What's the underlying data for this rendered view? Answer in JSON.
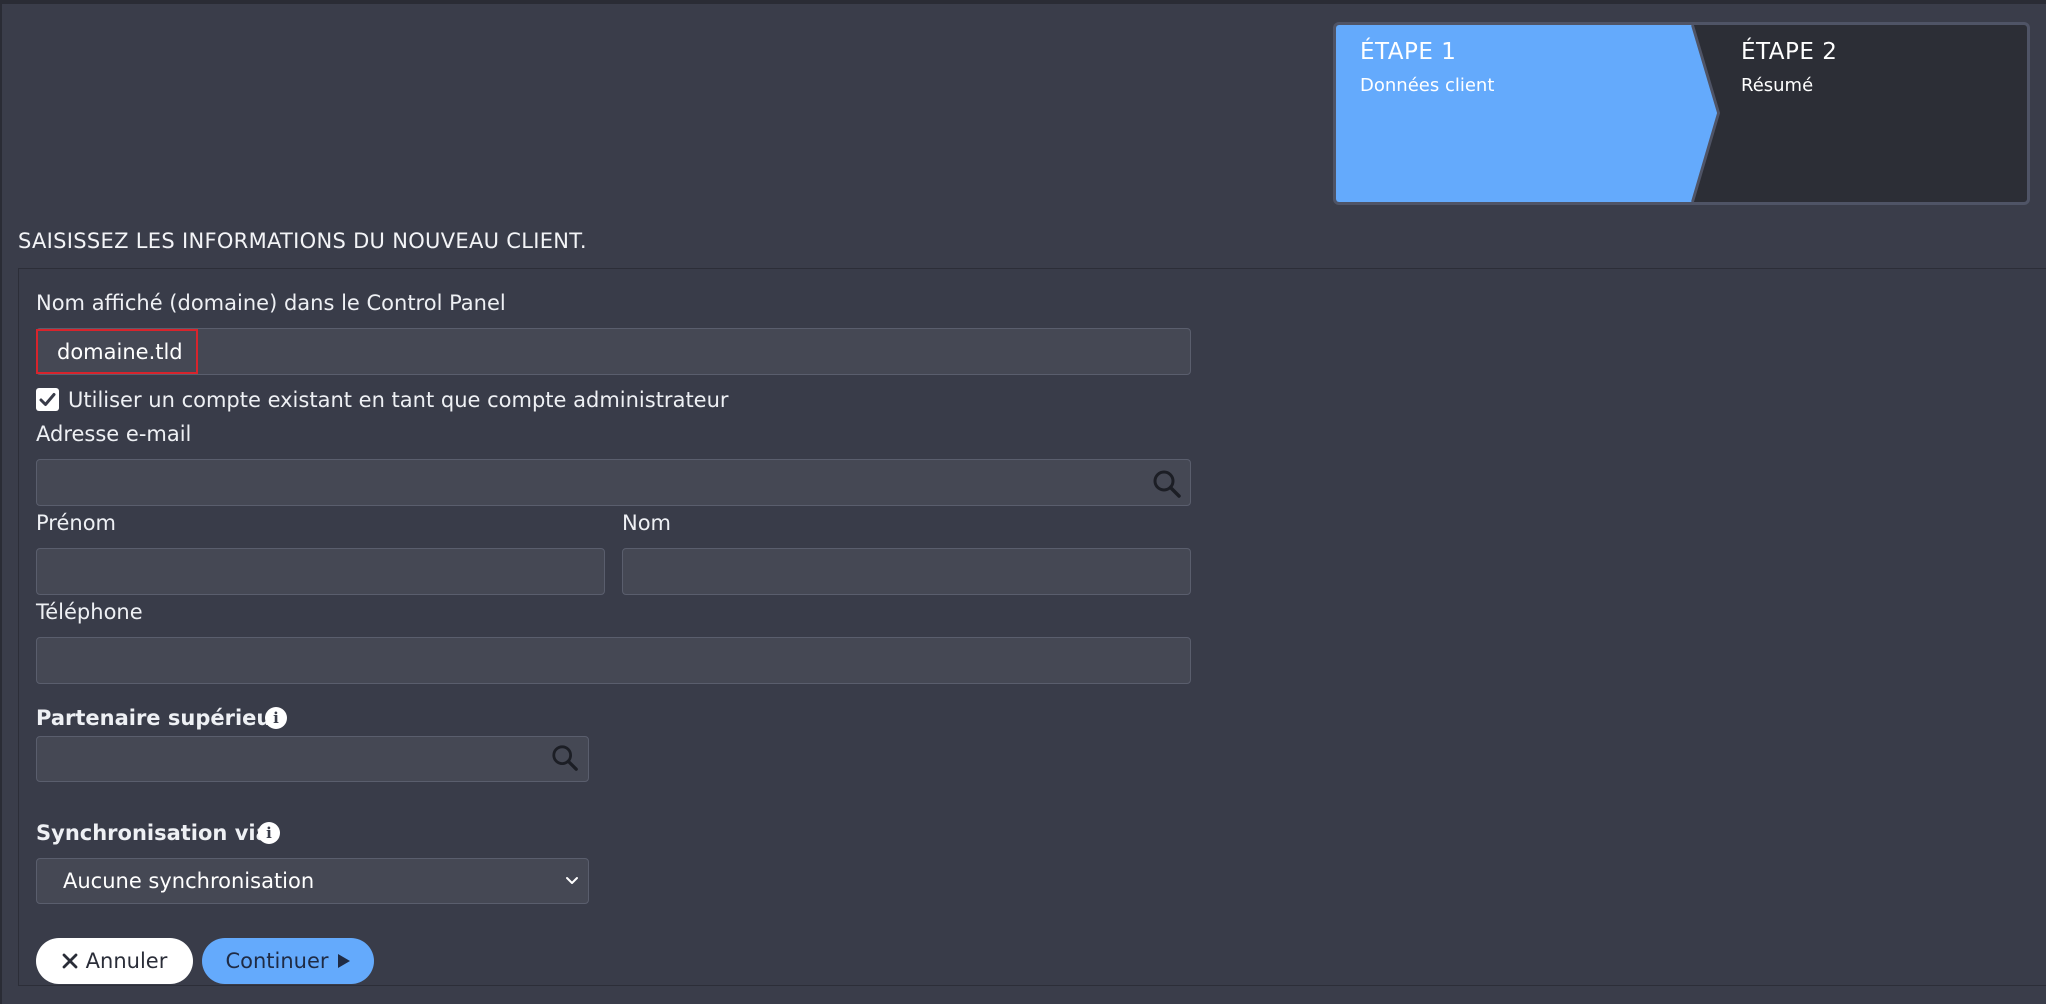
{
  "steps": [
    {
      "title": "ÉTAPE 1",
      "subtitle": "Données client",
      "active": true
    },
    {
      "title": "ÉTAPE 2",
      "subtitle": "Résumé",
      "active": false
    }
  ],
  "page": {
    "heading": "SAISISSEZ LES INFORMATIONS DU NOUVEAU CLIENT."
  },
  "form": {
    "domain_label": "Nom affiché (domaine) dans le Control Panel",
    "domain_value": "domaine.tld",
    "use_existing_label": "Utiliser un compte existant en tant que compte administrateur",
    "use_existing_checked": true,
    "email_label": "Adresse e-mail",
    "email_value": "",
    "firstname_label": "Prénom",
    "firstname_value": "",
    "lastname_label": "Nom",
    "lastname_value": "",
    "phone_label": "Téléphone",
    "phone_value": "",
    "partner_label": "Partenaire supérieur",
    "partner_value": "",
    "sync_label": "Synchronisation via",
    "sync_selected": "Aucune synchronisation"
  },
  "buttons": {
    "cancel": "Annuler",
    "continue": "Continuer"
  },
  "icons": {
    "search": "search-icon",
    "info": "info-icon",
    "check": "check-icon",
    "close": "close-icon",
    "play": "play-icon",
    "chevron": "chevron-down-icon"
  },
  "colors": {
    "accent": "#64aafc",
    "background": "#3a3d4a",
    "input_bg": "#454854",
    "highlight_border": "#d8242c"
  }
}
